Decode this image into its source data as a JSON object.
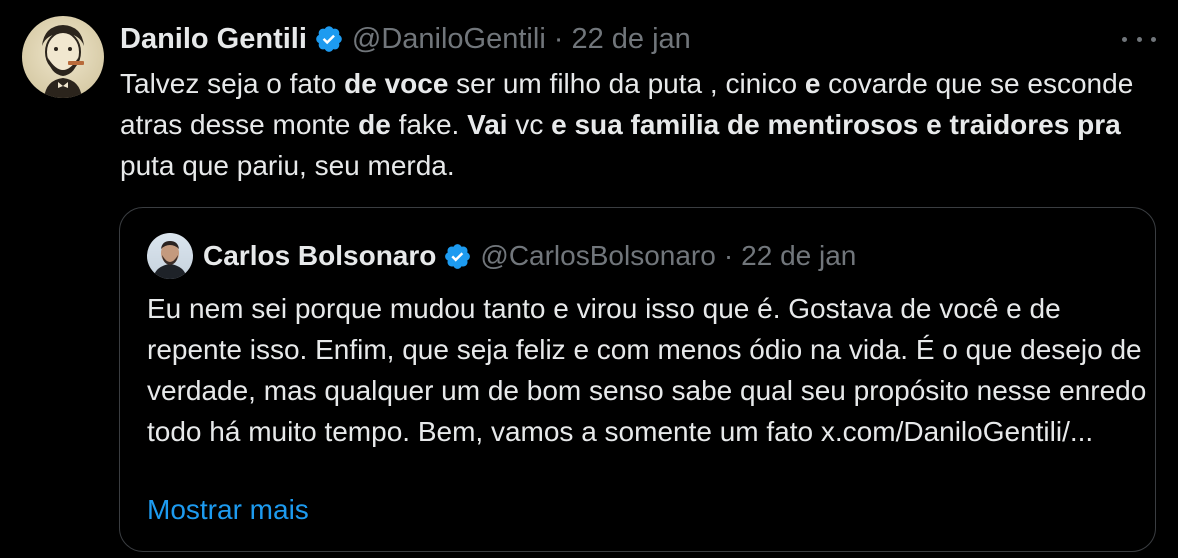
{
  "tweet": {
    "author_name": "Danilo Gentili",
    "author_handle": "@DaniloGentili",
    "separator": "·",
    "date": "22 de jan",
    "text_segments": [
      {
        "t": "Talvez seja o fato ",
        "b": false
      },
      {
        "t": "de voce",
        "b": true
      },
      {
        "t": " ser um filho da puta , cinico ",
        "b": false
      },
      {
        "t": "e",
        "b": true
      },
      {
        "t": " covarde que se esconde atras desse monte ",
        "b": false
      },
      {
        "t": "de",
        "b": true
      },
      {
        "t": " fake. ",
        "b": false
      },
      {
        "t": "Vai",
        "b": true
      },
      {
        "t": " vc ",
        "b": false
      },
      {
        "t": "e sua familia  de mentirosos e traidores pra",
        "b": true
      },
      {
        "t": " puta que pariu, seu merda.",
        "b": false
      }
    ]
  },
  "quote": {
    "author_name": "Carlos Bolsonaro",
    "author_handle": "@CarlosBolsonaro",
    "separator": "·",
    "date": "22 de jan",
    "text": "Eu nem sei porque mudou tanto e virou isso que é. Gostava de você e de repente isso. Enfim, que seja feliz e com menos ódio na vida. É o que desejo de verdade, mas qualquer um de bom senso sabe qual seu propósito nesse enredo todo há muito tempo. Bem, vamos a somente um fato x.com/DaniloGentili/...",
    "show_more": "Mostrar mais"
  },
  "icons": {
    "verified": "verified-badge-icon",
    "more": "more-options-icon"
  },
  "colors": {
    "background": "#000000",
    "text_primary": "#e7e9ea",
    "text_secondary": "#71767b",
    "link": "#1d9bf0",
    "verified": "#1d9bf0",
    "border": "#3a3d41"
  }
}
